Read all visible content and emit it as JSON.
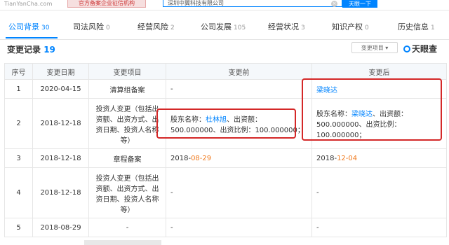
{
  "topbar": {
    "logo": "TianYanCha.com",
    "cert": "官方备案企业征信机构",
    "search_value": "深圳中翼科技有限公司",
    "search_button": "天眼一下"
  },
  "tabs": [
    {
      "label": "公司背景",
      "count": "30"
    },
    {
      "label": "司法风险",
      "count": "0"
    },
    {
      "label": "经营风险",
      "count": "2"
    },
    {
      "label": "公司发展",
      "count": "105"
    },
    {
      "label": "经营状况",
      "count": "3"
    },
    {
      "label": "知识产权",
      "count": "0"
    },
    {
      "label": "历史信息",
      "count": "1"
    }
  ],
  "section": {
    "title": "变更记录",
    "count": "19",
    "filter_label": "变更项目",
    "brand": "天眼查"
  },
  "table": {
    "headers": [
      "序号",
      "变更日期",
      "变更项目",
      "变更前",
      "变更后"
    ],
    "rows": [
      {
        "idx": "1",
        "date": "2020-04-15",
        "item": "清算组备案",
        "before": [
          {
            "t": "-",
            "s": ""
          }
        ],
        "after": [
          {
            "t": "梁晓达",
            "s": "link"
          }
        ]
      },
      {
        "idx": "2",
        "date": "2018-12-18",
        "item": "投资人变更（包括出资额、出资方式、出资日期、投资人名称等）",
        "before": [
          {
            "t": "股东名称：",
            "s": ""
          },
          {
            "t": "杜林旭",
            "s": "link"
          },
          {
            "t": "、出资额：500.000000、出资比例：100.000000；",
            "s": ""
          }
        ],
        "after": [
          {
            "t": "股东名称：",
            "s": ""
          },
          {
            "t": "梁晓达",
            "s": "link"
          },
          {
            "t": "、出资额：500.000000、出资比例：100.000000；",
            "s": ""
          }
        ]
      },
      {
        "idx": "3",
        "date": "2018-12-18",
        "item": "章程备案",
        "before": [
          {
            "t": "2018-",
            "s": ""
          },
          {
            "t": "08-29",
            "s": "orange"
          }
        ],
        "after": [
          {
            "t": "2018-",
            "s": ""
          },
          {
            "t": "12-04",
            "s": "orange"
          }
        ]
      },
      {
        "idx": "4",
        "date": "2018-12-18",
        "item": "投资人变更（包括出资额、出资方式、出资日期、投资人名称等）",
        "before": [
          {
            "t": "-",
            "s": ""
          }
        ],
        "after": [
          {
            "t": "-",
            "s": ""
          }
        ]
      },
      {
        "idx": "5",
        "date": "2018-08-29",
        "item": "-",
        "before": [
          {
            "t": "-",
            "s": ""
          }
        ],
        "after": [
          {
            "t": "-",
            "s": ""
          }
        ]
      }
    ]
  }
}
